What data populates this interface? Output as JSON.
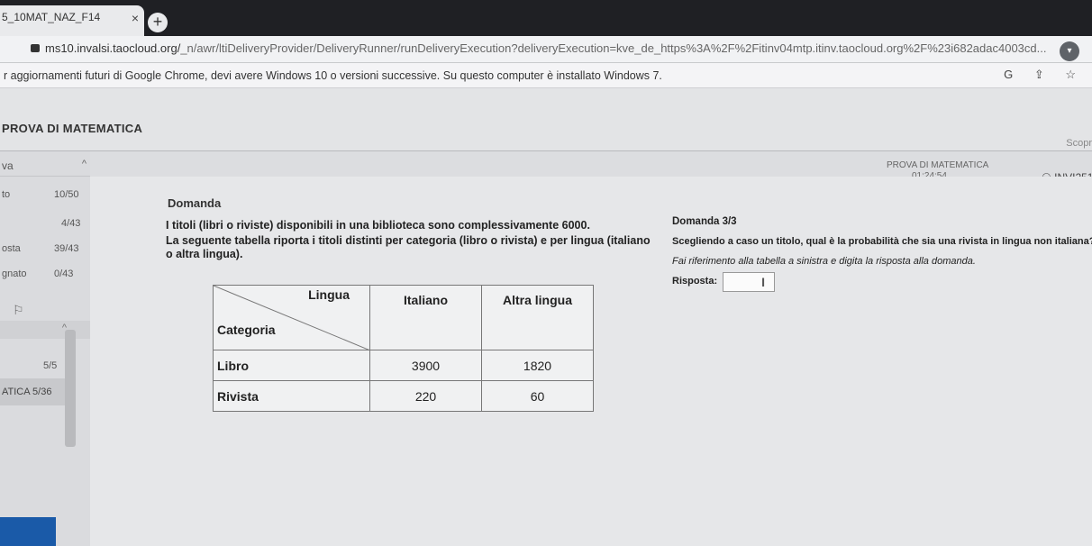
{
  "browser": {
    "tab_title": "5_10MAT_NAZ_F14",
    "tab_close": "×",
    "new_tab": "+",
    "url_domain": "ms10.invalsi.taocloud.org/",
    "url_path": "_n/awr/ltiDeliveryProvider/DeliveryRunner/runDeliveryExecution?deliveryExecution=kve_de_https%3A%2F%2Fitinv04mtp.itinv.taocloud.org%2F%23i682adac4003cd...",
    "ext_label": "G",
    "right_icons": "G ⇪ ☆"
  },
  "infobar": {
    "text": "r aggiornamenti futuri di Google Chrome, devi avere Windows 10 o versioni successive. Su questo computer è installato Windows 7."
  },
  "app": {
    "title": "PROVA DI MATEMATICA",
    "scope_label": "Scopr",
    "timer_label": "PROVA DI MATEMATICA",
    "timer": "01:24:54",
    "user_id": "INVI251"
  },
  "sidebar": {
    "header": "va",
    "rows": [
      {
        "label": "to",
        "value": "10/50"
      },
      {
        "label": "",
        "value": "4/43"
      },
      {
        "label": "osta",
        "value": "39/43"
      },
      {
        "label": "gnato",
        "value": "0/43"
      }
    ],
    "section_count": "5/5",
    "selected_item": "ATICA 5/36",
    "flag_icon": "flag-icon",
    "prev_arrow": "‹"
  },
  "question": {
    "heading": "Domanda",
    "paragraph1": "I titoli (libri o riviste) disponibili in una biblioteca sono complessivamente 6000.",
    "paragraph2": "La seguente tabella riporta i titoli distinti per categoria (libro o rivista) e per lingua (italiano o altra lingua).",
    "table": {
      "header_top": "Lingua",
      "header_left": "Categoria",
      "columns": [
        "Italiano",
        "Altra lingua"
      ],
      "rows": [
        {
          "category": "Libro",
          "values": [
            "3900",
            "1820"
          ]
        },
        {
          "category": "Rivista",
          "values": [
            "220",
            "60"
          ]
        }
      ]
    }
  },
  "panel": {
    "domanda_num": "Domanda 3/3",
    "question": "Scegliendo a caso un titolo, qual è la probabilità che sia una rivista in lingua non italiana?",
    "hint": "Fai riferimento alla tabella a sinistra e digita la risposta alla domanda.",
    "answer_label": "Risposta:",
    "answer_value": "",
    "cursor": "I"
  }
}
